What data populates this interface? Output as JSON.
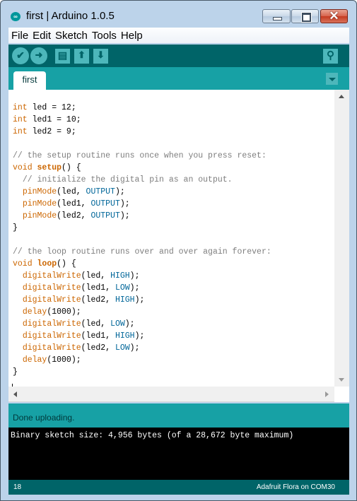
{
  "window": {
    "title": "first | Arduino 1.0.5",
    "app_icon": "arduino-logo-icon",
    "controls": {
      "minimize": "minimize-icon",
      "maximize": "maximize-icon",
      "close_glyph": "✕"
    }
  },
  "menubar": {
    "items": [
      "File",
      "Edit",
      "Sketch",
      "Tools",
      "Help"
    ]
  },
  "toolbar": {
    "buttons": [
      {
        "name": "verify",
        "icon": "checkmark-icon",
        "glyph": "✔"
      },
      {
        "name": "upload",
        "icon": "arrow-right-icon",
        "glyph": "➜"
      },
      {
        "name": "new",
        "icon": "new-document-icon",
        "glyph": "▤"
      },
      {
        "name": "open",
        "icon": "arrow-up-icon",
        "glyph": "⬆"
      },
      {
        "name": "save",
        "icon": "arrow-down-icon",
        "glyph": "⬇"
      },
      {
        "name": "serial-monitor",
        "icon": "magnifier-icon",
        "glyph": "⚲"
      }
    ]
  },
  "tabs": {
    "items": [
      "first"
    ],
    "menu_icon": "tab-menu-down-icon"
  },
  "editor": {
    "lines": [
      "int led = 12;",
      "int led1 = 10;",
      "int led2 = 9;",
      "",
      "// the setup routine runs once when you press reset:",
      "void setup() {",
      "  // initialize the digital pin as an output.",
      "  pinMode(led, OUTPUT);",
      "  pinMode(led1, OUTPUT);",
      "  pinMode(led2, OUTPUT);",
      "}",
      "",
      "// the loop routine runs over and over again forever:",
      "void loop() {",
      "  digitalWrite(led, HIGH);",
      "  digitalWrite(led1, LOW);",
      "  digitalWrite(led2, HIGH);",
      "  delay(1000);",
      "  digitalWrite(led, LOW);",
      "  digitalWrite(led1, HIGH);",
      "  digitalWrite(led2, LOW);",
      "  delay(1000);",
      "}"
    ],
    "cursor_line": 17
  },
  "status": {
    "message": "Done uploading."
  },
  "console": {
    "output": "Binary sketch size: 4,956 bytes (of a 28,672 byte maximum)"
  },
  "footer": {
    "line_number": "18",
    "board": "Adafruit Flora on COM30"
  },
  "colors": {
    "toolbar_dark_teal": "#006468",
    "tab_teal": "#17a1a5",
    "button_teal": "#4db7bb",
    "keyword_orange": "#cc6600",
    "constant_blue": "#006699",
    "comment_gray": "#7e7e7e"
  }
}
